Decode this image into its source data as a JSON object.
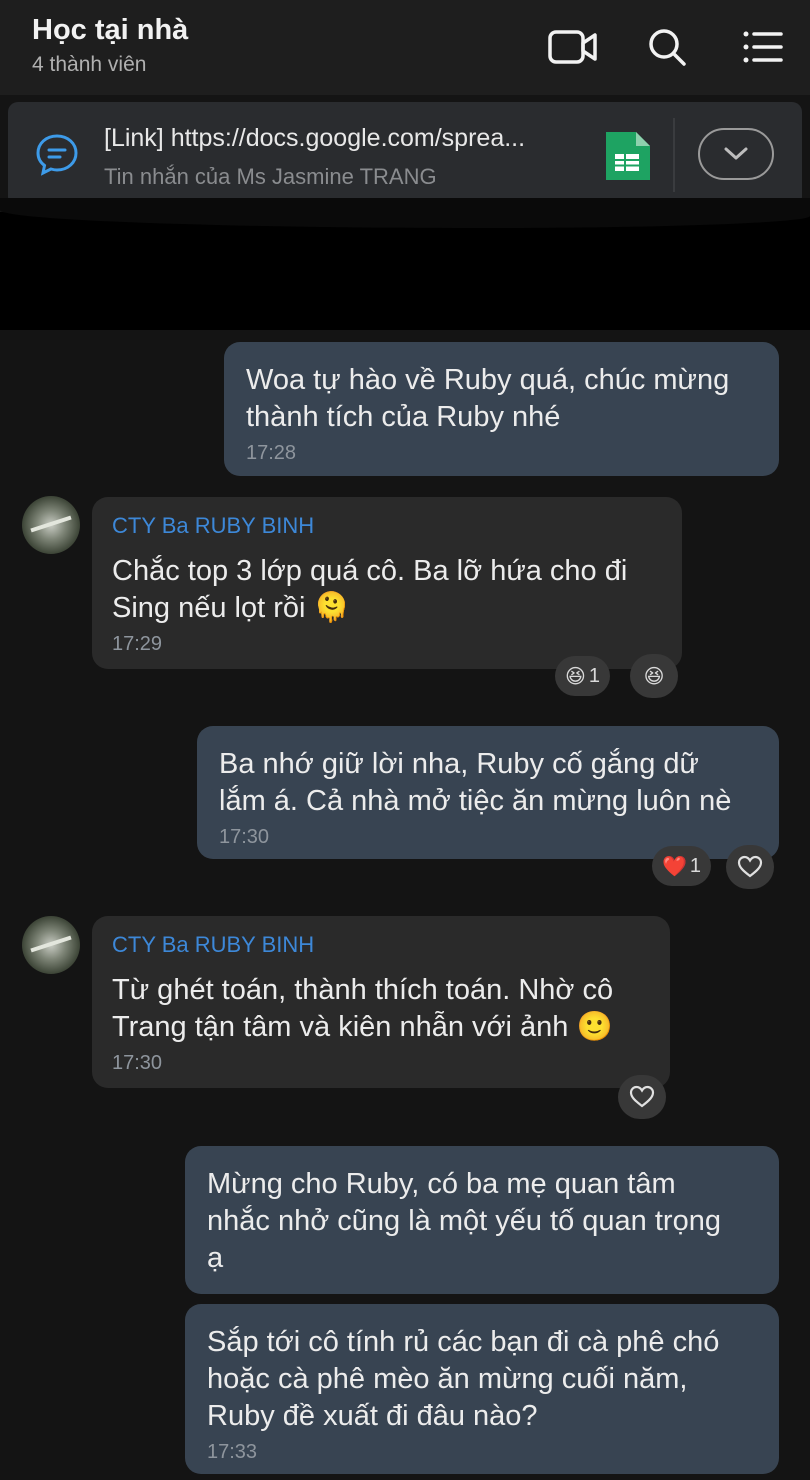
{
  "header": {
    "title": "Học tại nhà",
    "subtitle": "4 thành viên",
    "icons": [
      "video-call-icon",
      "search-icon",
      "menu-icon"
    ]
  },
  "pinned": {
    "title": "[Link] https://docs.google.com/sprea...",
    "subtitle": "Tin nhắn của Ms Jasmine TRANG",
    "icons": [
      "message-icon",
      "google-sheets-icon",
      "chevron-down-icon"
    ]
  },
  "messages": [
    {
      "side": "sent",
      "text_lines": [
        "Woa tự hào về Ruby quá, chúc mừng",
        "thành tích của Ruby nhé"
      ],
      "time": "17:28"
    },
    {
      "side": "received",
      "sender": "CTY Ba RUBY BINH",
      "text_lines": [
        "Chắc top 3 lớp quá cô. Ba lỡ hứa cho đi",
        "Sing nếu lọt rồi 🫠"
      ],
      "time": "17:29",
      "reactions": [
        {
          "emoji": "😆",
          "count": "1"
        },
        {
          "emoji": "😆",
          "count": ""
        }
      ]
    },
    {
      "side": "sent",
      "text_lines": [
        "Ba nhớ giữ lời nha, Ruby cố gắng dữ",
        "lắm á. Cả nhà mở tiệc ăn mừng luôn nè"
      ],
      "time": "17:30",
      "reactions": [
        {
          "emoji": "❤️",
          "count": "1"
        },
        {
          "emoji": "heart-outline-icon",
          "count": ""
        }
      ]
    },
    {
      "side": "received",
      "sender": "CTY Ba RUBY BINH",
      "text_lines": [
        "Từ ghét toán, thành thích toán. Nhờ cô",
        "Trang tận tâm và kiên nhẫn với ảnh 🙂"
      ],
      "time": "17:30",
      "reactions": [
        {
          "emoji": "heart-outline-icon",
          "count": ""
        }
      ]
    },
    {
      "side": "sent",
      "text_lines": [
        "Mừng cho Ruby, có ba mẹ quan tâm",
        "nhắc nhở cũng là một yếu tố quan trọng",
        "ạ"
      ],
      "time": ""
    },
    {
      "side": "sent",
      "text_lines": [
        "Sắp tới cô tính rủ các bạn đi cà phê chó",
        "hoặc cà phê mèo ăn mừng cuối năm,",
        "Ruby đề xuất đi đâu nào?"
      ],
      "time": "17:33"
    }
  ],
  "colors": {
    "background": "#141414",
    "sent_bubble": "#384452",
    "received_bubble": "#2a2a2a",
    "sender_name": "#3d88d8",
    "time": "#8e959d"
  }
}
